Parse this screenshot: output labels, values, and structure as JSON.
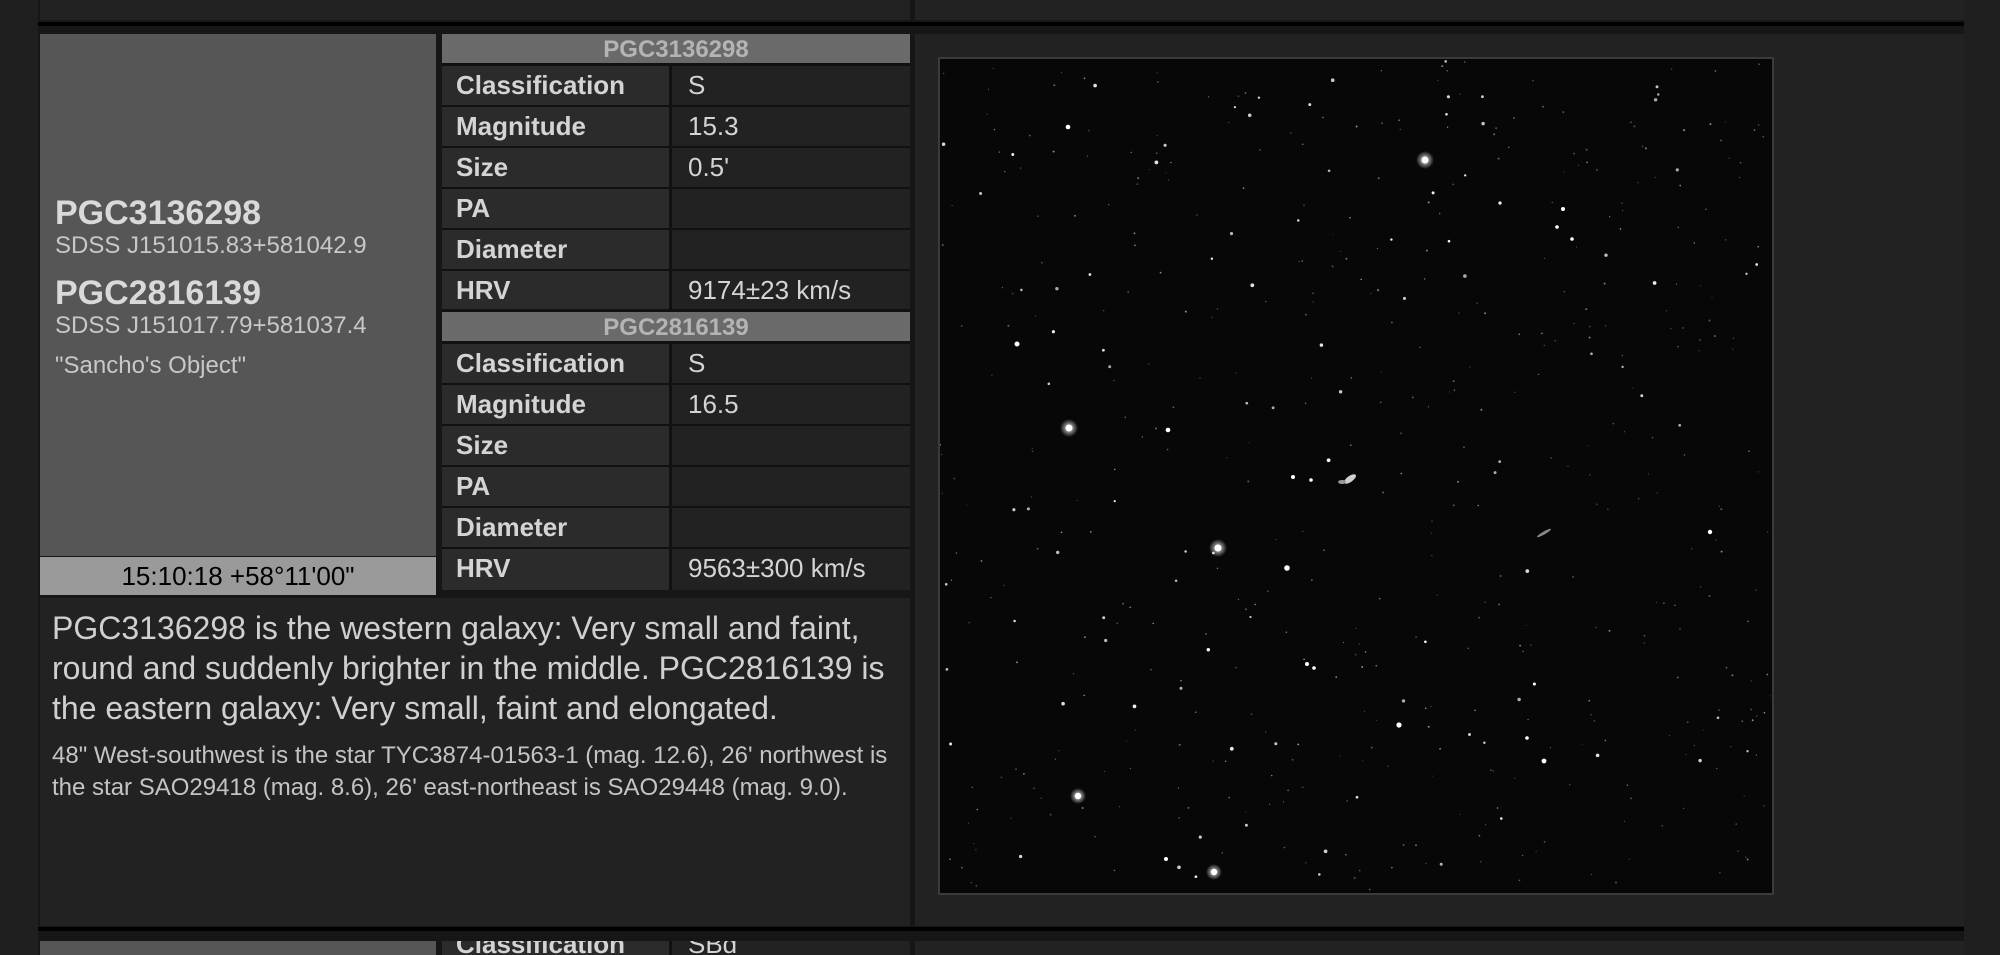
{
  "objects": [
    {
      "name": "PGC3136298",
      "sdss": "SDSS J151015.83+581042.9"
    },
    {
      "name": "PGC2816139",
      "sdss": "SDSS J151017.79+581037.4"
    }
  ],
  "nickname": "\"Sancho's Object\"",
  "coordinates": "15:10:18 +58°11'00\"",
  "tables": [
    {
      "header": "PGC3136298",
      "rows": [
        {
          "key": "Classification",
          "value": "S"
        },
        {
          "key": "Magnitude",
          "value": "15.3"
        },
        {
          "key": "Size",
          "value": "0.5'"
        },
        {
          "key": "PA",
          "value": ""
        },
        {
          "key": "Diameter",
          "value": ""
        },
        {
          "key": "HRV",
          "value": "9174±23 km/s"
        }
      ]
    },
    {
      "header": "PGC2816139",
      "rows": [
        {
          "key": "Classification",
          "value": "S"
        },
        {
          "key": "Magnitude",
          "value": "16.5"
        },
        {
          "key": "Size",
          "value": ""
        },
        {
          "key": "PA",
          "value": ""
        },
        {
          "key": "Diameter",
          "value": ""
        },
        {
          "key": "HRV",
          "value": "9563±300 km/s"
        }
      ]
    }
  ],
  "description": {
    "main": "PGC3136298 is the western galaxy: Very small and faint, round and suddenly brighter in the middle. PGC2816139 is the eastern galaxy: Very small, faint and elongated.",
    "sub": "48\" West-southwest is the star TYC3874-01563-1 (mag. 12.6), 26' northwest is the star SAO29418 (mag. 8.6), 26' east-northeast is SAO29448 (mag. 9.0)."
  },
  "next_entry": {
    "key": "Classification",
    "value": "SBd"
  }
}
